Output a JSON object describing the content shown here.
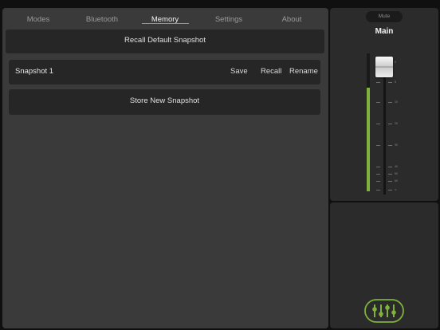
{
  "tabs": [
    {
      "label": "Modes",
      "active": false
    },
    {
      "label": "Bluetooth",
      "active": false
    },
    {
      "label": "Memory",
      "active": true
    },
    {
      "label": "Settings",
      "active": false
    },
    {
      "label": "About",
      "active": false
    }
  ],
  "recall_default_label": "Recall Default Snapshot",
  "snapshots": [
    {
      "name": "Snapshot 1",
      "actions": [
        "Save",
        "Recall",
        "Rename"
      ]
    }
  ],
  "store_new_label": "Store New Snapshot",
  "channel": {
    "mute_label": "Mute",
    "name": "Main",
    "fader_level": 0.93,
    "meter_level": 0.75,
    "scale_labels": [
      "0",
      "5",
      "10",
      "20",
      "30",
      "40",
      "50",
      "60",
      "∞"
    ]
  },
  "colors": {
    "accent": "#7fb13b",
    "panel": "#3a3a3a",
    "bar": "#262626"
  },
  "icons": {
    "logo": "mixer-faders-logo"
  }
}
